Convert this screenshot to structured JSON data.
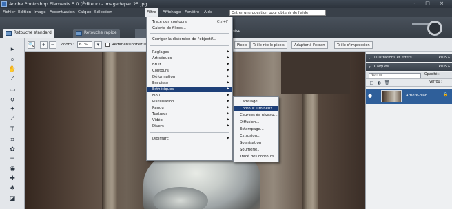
{
  "window": {
    "title": "Adobe Photoshop Elements 5.0 (Éditeur) - imagedepart25.jpg",
    "controls": "- □ ×"
  },
  "menubar": {
    "items": [
      "Fichier",
      "Edition",
      "Image",
      "Accentuation",
      "Calque",
      "Sélection",
      "Filtre",
      "Affichage",
      "Fenêtre",
      "Aide"
    ],
    "active": "Filtre",
    "help_box": "Entrer une question pour obtenir de l'aide"
  },
  "mode_tabs": {
    "standard": "Retouche standard",
    "quick": "Retouche rapide",
    "fourth": "ganise"
  },
  "options_bar": {
    "zoom_label": "Zoom :",
    "zoom_value": "61%",
    "resize_checkbox": "Redimensionner la",
    "buttons": [
      "Pixels",
      "Taille réelle pixels",
      "Adapter à l'écran",
      "Taille d'impression"
    ]
  },
  "filter_menu": {
    "items": [
      {
        "label": "Tracé des contours",
        "shortcut": "Ctrl+F"
      },
      {
        "label": "Galerie de filtres..."
      },
      {
        "label": "Corriger la distorsion de l'objectif..."
      },
      {
        "label": "Réglages",
        "submenu": true
      },
      {
        "label": "Artistiques",
        "submenu": true
      },
      {
        "label": "Bruit",
        "submenu": true
      },
      {
        "label": "Contours",
        "submenu": true
      },
      {
        "label": "Déformation",
        "submenu": true
      },
      {
        "label": "Esquisse",
        "submenu": true
      },
      {
        "label": "Esthétiques",
        "submenu": true,
        "highlighted": true
      },
      {
        "label": "Flou",
        "submenu": true
      },
      {
        "label": "Pixellisation",
        "submenu": true
      },
      {
        "label": "Rendu",
        "submenu": true
      },
      {
        "label": "Textures",
        "submenu": true
      },
      {
        "label": "Vidéo",
        "submenu": true
      },
      {
        "label": "Divers",
        "submenu": true
      },
      {
        "label": "Digimarc",
        "submenu": true
      }
    ]
  },
  "esthetiques_submenu": {
    "items": [
      {
        "label": "Carrelage..."
      },
      {
        "label": "Contour lumineux...",
        "highlighted": true
      },
      {
        "label": "Courbes de niveau..."
      },
      {
        "label": "Diffusion..."
      },
      {
        "label": "Estampage..."
      },
      {
        "label": "Extrusion..."
      },
      {
        "label": "Solarisation"
      },
      {
        "label": "Soufflerie..."
      },
      {
        "label": "Tracé des contours"
      }
    ]
  },
  "palettes": {
    "effects_header": "Illustrations et effets",
    "effects_more": "PLUS ▸",
    "layers_header": "Calques",
    "layers_more": "PLUS ▸",
    "blend_mode": "Normal",
    "opacity_label": "Opacité :",
    "lock_label": "Verrou :",
    "layer_name": "Arrière-plan"
  },
  "colors": {
    "menu_highlight": "#1d3f78",
    "layer_selected": "#2f5f9a",
    "chrome_dark": "#394049"
  }
}
